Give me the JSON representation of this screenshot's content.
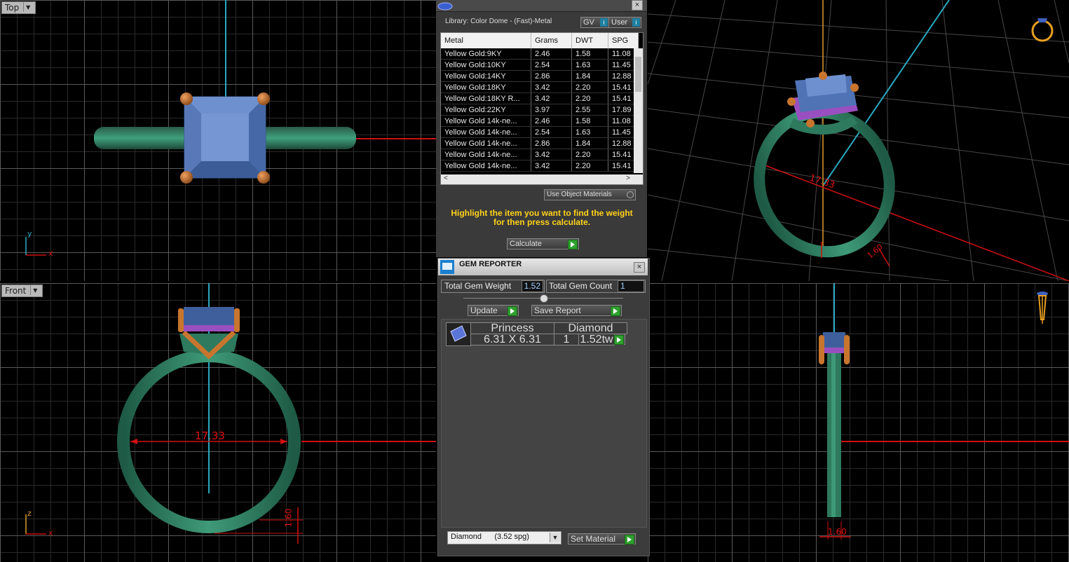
{
  "viewports": {
    "top": {
      "label": "Top"
    },
    "front": {
      "label": "Front"
    }
  },
  "axis": {
    "x": "x",
    "y": "y",
    "z": "z"
  },
  "dimensions": {
    "front_diameter": "17.33",
    "persp_diameter": "17.33",
    "front_band": "1.60",
    "side_band": "1.60",
    "persp_band": "1.60"
  },
  "library": {
    "title": "Library: Color Dome - (Fast)-Metal",
    "btn_gv": "GV",
    "btn_user": "User",
    "columns": [
      "Metal",
      "Grams",
      "DWT",
      "SPG"
    ],
    "rows": [
      [
        "Yellow Gold:9KY",
        "2.46",
        "1.58",
        "11.08"
      ],
      [
        "Yellow Gold:10KY",
        "2.54",
        "1.63",
        "11.45"
      ],
      [
        "Yellow Gold:14KY",
        "2.86",
        "1.84",
        "12.88"
      ],
      [
        "Yellow Gold:18KY",
        "3.42",
        "2.20",
        "15.41"
      ],
      [
        "Yellow Gold:18KY R...",
        "3.42",
        "2.20",
        "15.41"
      ],
      [
        "Yellow Gold:22KY",
        "3.97",
        "2.55",
        "17.89"
      ],
      [
        "Yellow Gold 14k-ne...",
        "2.46",
        "1.58",
        "11.08"
      ],
      [
        "Yellow Gold 14k-ne...",
        "2.54",
        "1.63",
        "11.45"
      ],
      [
        "Yellow Gold 14k-ne...",
        "2.86",
        "1.84",
        "12.88"
      ],
      [
        "Yellow Gold 14k-ne...",
        "3.42",
        "2.20",
        "15.41"
      ],
      [
        "Yellow Gold 14k-ne...",
        "3.42",
        "2.20",
        "15.41"
      ]
    ],
    "use_object_materials": "Use Object Materials",
    "instruction": "Highlight the item you want to find the weight for then press calculate.",
    "calculate": "Calculate"
  },
  "gem_reporter": {
    "title": "GEM REPORTER",
    "total_weight_label": "Total Gem Weight",
    "total_weight_value": "1.52",
    "total_count_label": "Total Gem Count",
    "total_count_value": "1",
    "update": "Update",
    "save_report": "Save Report",
    "gem": {
      "cut": "Princess",
      "material": "Diamond",
      "size": "6.31 X 6.31",
      "qty": "1",
      "weight": "1.52tw"
    },
    "material_select": "Diamond      (3.52 spg)",
    "set_material": "Set Material"
  },
  "colors": {
    "band": "#2e7a5e",
    "stone": "#5a7fc0",
    "prong": "#c8752e",
    "accent_text": "#ffd21a",
    "dimension": "#e01010"
  }
}
